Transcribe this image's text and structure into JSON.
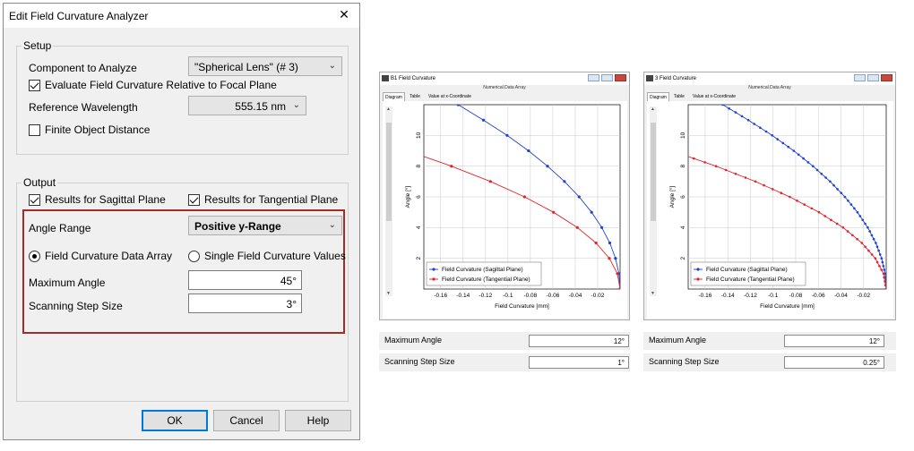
{
  "dialog": {
    "title": "Edit Field Curvature Analyzer",
    "close_glyph": "✕",
    "setup": {
      "group_title": "Setup",
      "component_label": "Component to Analyze",
      "component_value": "\"Spherical Lens\" (# 3)",
      "evaluate_label": "Evaluate Field Curvature Relative to Focal Plane",
      "evaluate_checked": true,
      "wavelength_label": "Reference Wavelength",
      "wavelength_value": "555.15 nm",
      "finite_label": "Finite Object Distance",
      "finite_checked": false
    },
    "output": {
      "group_title": "Output",
      "sagittal_label": "Results for Sagittal Plane",
      "sagittal_checked": true,
      "tangential_label": "Results for Tangential Plane",
      "tangential_checked": true,
      "angle_range_label": "Angle Range",
      "angle_range_value": "Positive y-Range",
      "data_array_label": "Field Curvature Data Array",
      "single_values_label": "Single Field Curvature Values",
      "selected_mode": "data_array",
      "max_angle_label": "Maximum Angle",
      "max_angle_value": "45°",
      "step_label": "Scanning Step Size",
      "step_value": "3°"
    },
    "buttons": {
      "ok": "OK",
      "cancel": "Cancel",
      "help": "Help"
    }
  },
  "colors": {
    "sagittal": "#1f3fd6",
    "tangential": "#e0242b",
    "highlight": "#a52a2a",
    "ok_focus": "#0078d7"
  },
  "windows": [
    {
      "title": "B1 Field Curvature",
      "subtitle": "Numerical Data Array",
      "tabs": [
        "Diagram",
        "Table",
        "Value at x-Coordinate"
      ],
      "params": {
        "max_angle_label": "Maximum Angle",
        "max_angle_value": "12°",
        "step_label": "Scanning Step Size",
        "step_value": "1°"
      }
    },
    {
      "title": "3 Field Curvature",
      "subtitle": "Numerical Data Array",
      "tabs": [
        "Diagram",
        "Table",
        "Value at x-Coordinate"
      ],
      "params": {
        "max_angle_label": "Maximum Angle",
        "max_angle_value": "12°",
        "step_label": "Scanning Step Size",
        "step_value": "0.25°"
      }
    }
  ],
  "chart_data": [
    {
      "type": "line",
      "title": "",
      "xlabel": "Field Curvature [mm]",
      "ylabel": "Angle [°]",
      "xlim": [
        -0.175,
        0
      ],
      "ylim": [
        0,
        12
      ],
      "xticks": [
        "-0.16",
        "-0.14",
        "-0.12",
        "-0.1",
        "-0.08",
        "-0.06",
        "-0.04",
        "-0.02"
      ],
      "yticks": [
        "2",
        "4",
        "6",
        "8",
        "10"
      ],
      "legend_position": "bottom-left",
      "series": [
        {
          "name": "Field Curvature (Sagittal Plane)",
          "color": "#1f3fd6",
          "x": [
            0,
            -0.001,
            -0.0041,
            -0.0092,
            -0.0163,
            -0.0254,
            -0.0365,
            -0.0496,
            -0.0647,
            -0.0817,
            -0.1008,
            -0.1219,
            -0.1444
          ],
          "y": [
            0,
            1,
            2,
            3,
            4,
            5,
            6,
            7,
            8,
            9,
            10,
            11,
            12
          ]
        },
        {
          "name": "Field Curvature (Tangential Plane)",
          "color": "#e0242b",
          "x": [
            0,
            -0.0024,
            -0.0096,
            -0.0215,
            -0.0381,
            -0.0594,
            -0.0852,
            -0.1156,
            -0.1504,
            -0.1896
          ],
          "y": [
            0,
            1,
            2,
            3,
            4,
            5,
            6,
            7,
            8,
            9
          ]
        }
      ]
    },
    {
      "type": "line",
      "title": "",
      "xlabel": "Field Curvature [mm]",
      "ylabel": "Angle [°]",
      "xlim": [
        -0.175,
        0
      ],
      "ylim": [
        0,
        12
      ],
      "xticks": [
        "-0.16",
        "-0.14",
        "-0.12",
        "-0.1",
        "-0.08",
        "-0.06",
        "-0.04",
        "-0.02"
      ],
      "yticks": [
        "2",
        "4",
        "6",
        "8",
        "10"
      ],
      "legend_position": "bottom-left",
      "series": [
        {
          "name": "Field Curvature (Sagittal Plane)",
          "color": "#1f3fd6",
          "dense": true,
          "x": [
            0,
            -0.001,
            -0.0041,
            -0.0092,
            -0.0163,
            -0.0254,
            -0.0365,
            -0.0496,
            -0.0647,
            -0.0817,
            -0.1008,
            -0.1219,
            -0.1444
          ],
          "y": [
            0,
            1,
            2,
            3,
            4,
            5,
            6,
            7,
            8,
            9,
            10,
            11,
            12
          ]
        },
        {
          "name": "Field Curvature (Tangential Plane)",
          "color": "#e0242b",
          "dense": true,
          "x": [
            0,
            -0.0024,
            -0.0096,
            -0.0215,
            -0.0381,
            -0.0594,
            -0.0852,
            -0.1156,
            -0.1504,
            -0.1896
          ],
          "y": [
            0,
            1,
            2,
            3,
            4,
            5,
            6,
            7,
            8,
            9
          ]
        }
      ]
    }
  ]
}
